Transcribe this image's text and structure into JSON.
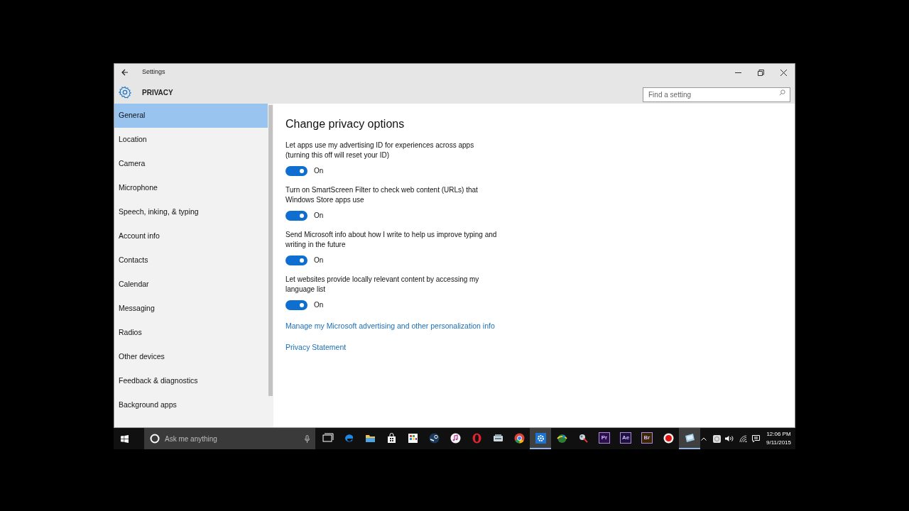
{
  "window": {
    "title": "Settings",
    "section": "PRIVACY",
    "search": {
      "placeholder": "Find a setting"
    }
  },
  "sidebar": {
    "items": [
      {
        "label": "General",
        "selected": true
      },
      {
        "label": "Location",
        "selected": false
      },
      {
        "label": "Camera",
        "selected": false
      },
      {
        "label": "Microphone",
        "selected": false
      },
      {
        "label": "Speech, inking, & typing",
        "selected": false
      },
      {
        "label": "Account info",
        "selected": false
      },
      {
        "label": "Contacts",
        "selected": false
      },
      {
        "label": "Calendar",
        "selected": false
      },
      {
        "label": "Messaging",
        "selected": false
      },
      {
        "label": "Radios",
        "selected": false
      },
      {
        "label": "Other devices",
        "selected": false
      },
      {
        "label": "Feedback & diagnostics",
        "selected": false
      },
      {
        "label": "Background apps",
        "selected": false
      }
    ]
  },
  "content": {
    "heading": "Change privacy options",
    "options": [
      {
        "description": "Let apps use my advertising ID for experiences across apps (turning this off will reset your ID)",
        "on": true,
        "state_label": "On"
      },
      {
        "description": "Turn on SmartScreen Filter to check web content (URLs) that Windows Store apps use",
        "on": true,
        "state_label": "On"
      },
      {
        "description": "Send Microsoft info about how I write to help us improve typing and writing in the future",
        "on": true,
        "state_label": "On"
      },
      {
        "description": "Let websites provide locally relevant content by accessing my language list",
        "on": true,
        "state_label": "On"
      }
    ],
    "links": [
      "Manage my Microsoft advertising and other personalization info",
      "Privacy Statement"
    ]
  },
  "taskbar": {
    "search_placeholder": "Ask me anything",
    "apps": [
      {
        "kind": "taskview",
        "active": false
      },
      {
        "kind": "edge",
        "active": false
      },
      {
        "kind": "folder",
        "active": false
      },
      {
        "kind": "store",
        "active": false
      },
      {
        "kind": "grid",
        "active": false
      },
      {
        "kind": "steam",
        "active": false
      },
      {
        "kind": "music",
        "active": false
      },
      {
        "kind": "opera",
        "active": false
      },
      {
        "kind": "scanner",
        "active": false
      },
      {
        "kind": "chrome",
        "active": false
      },
      {
        "kind": "gear",
        "active": true
      },
      {
        "kind": "globe",
        "active": false
      },
      {
        "kind": "tool",
        "active": false
      },
      {
        "kind": "letters",
        "label": "Pr",
        "color": "#2a0f4a",
        "active": false
      },
      {
        "kind": "letters",
        "label": "Ae",
        "color": "#1c1040",
        "active": false
      },
      {
        "kind": "letters",
        "label": "Br",
        "color": "#3b2500",
        "active": false
      },
      {
        "kind": "record",
        "active": false
      },
      {
        "kind": "window",
        "active": true
      }
    ],
    "time": "12:06 PM",
    "date": "9/11/2015"
  }
}
